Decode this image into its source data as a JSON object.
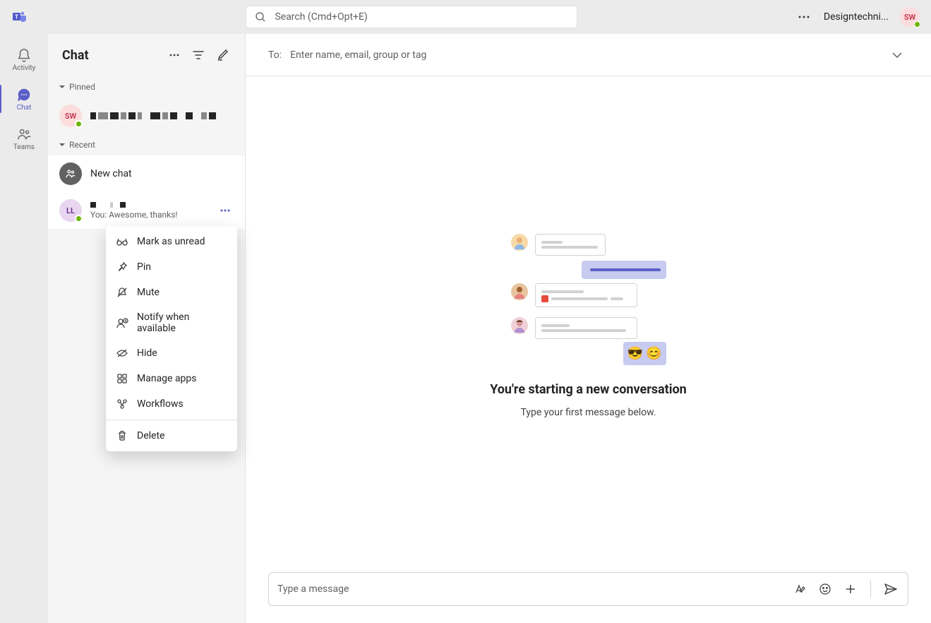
{
  "search": {
    "placeholder": "Search (Cmd+Opt+E)"
  },
  "user": {
    "name": "Designtechni...",
    "initials": "SW"
  },
  "nav": {
    "activity": "Activity",
    "chat": "Chat",
    "teams": "Teams"
  },
  "chat_panel": {
    "title": "Chat",
    "section_pinned": "Pinned",
    "section_recent": "Recent",
    "new_chat_label": "New chat",
    "pinned_chat": {
      "initials": "SW"
    },
    "recent_chat_ll": {
      "initials": "LL",
      "preview": "You: Awesome, thanks!"
    }
  },
  "context_menu": {
    "mark_unread": "Mark as unread",
    "pin": "Pin",
    "mute": "Mute",
    "notify": "Notify when available",
    "hide": "Hide",
    "manage_apps": "Manage apps",
    "workflows": "Workflows",
    "delete": "Delete"
  },
  "compose": {
    "to_label": "To:",
    "to_placeholder": "Enter name, email, group or tag",
    "message_placeholder": "Type a message"
  },
  "empty": {
    "title": "You're starting a new conversation",
    "subtitle": "Type your first message below."
  }
}
